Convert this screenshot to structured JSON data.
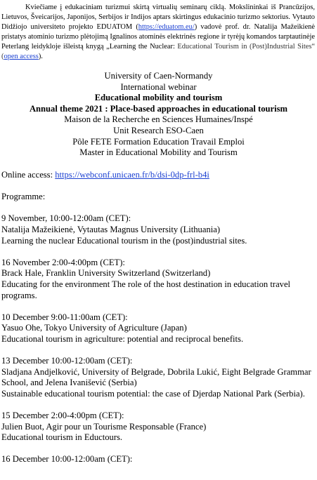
{
  "intro": {
    "t1": "Kviečiame į edukaciniam turizmui skirtą virtualių seminarų ciklą. Mokslininkai iš Prancūzijos, Lietuvos, Šveicarijos, Japonijos, Serbijos ir  Indijos aptars skirtingus edukacinio turizmo sektorius. Vytauto Didžiojo universiteto projekto EDUATOM (",
    "link1": "https://eduatom.eu/",
    "t2": ") vadovė prof. dr. Natalija Mažeikienė pristatys atominio turizmo plėtojimą Ignalinos atominės elektrinės regione ir tyrėjų komandos tarptautinėje Peterlang leidykloje išleistą knygą „Learning the Nuclear:",
    "t3": " Educational Tourism in (Post)Industrial Sites“ (",
    "link2": "open access",
    "t4": ")."
  },
  "header": {
    "university": "University of Caen-Normandy",
    "webinar": "International webinar",
    "title": "Educational mobility and tourism",
    "theme": "Annual theme 2021 : Place-based approaches in educational tourism",
    "org1": "Maison de la Recherche en Sciences Humaines/Inspé",
    "org2": "Unit Research ESO-Caen",
    "org3": "Pôle FETE Formation Education Travail Emploi",
    "org4": "Master in Educational Mobility and Tourism"
  },
  "access": {
    "label": "Online access: ",
    "url": "https://webconf.unicaen.fr/b/dsi-0dp-frl-b4i"
  },
  "programme_label": "Programme:",
  "sessions": [
    {
      "date": "9 November, 10:00-12:00am (CET):",
      "speaker": "Natalija Mažeikienė, Vytautas Magnus University (Lithuania)",
      "title": "Learning the nuclear Educational tourism in the (post)industrial sites."
    },
    {
      "date": "16 November 2:00-4:00pm (CET):",
      "speaker": "Brack Hale, Franklin University Switzerland (Switzerland)",
      "title": "Educating for the environment The role of the host destination in education travel programs."
    },
    {
      "date": "10 December 9:00-11:00am (CET):",
      "speaker": "Yasuo Ohe, Tokyo University of Agriculture (Japan)",
      "title": "Educational tourism in agriculture: potential and reciprocal benefits."
    },
    {
      "date": "13 December 10:00-12:00am (CET):",
      "speaker": "Sladjana Andjelković, University of Belgrade, Dobrila Lukić, Eight Belgrade Grammar School, and Jelena Ivanišević (Serbia)",
      "title": "Sustainable educational tourism potential: the case of Djerdap National Park (Serbia)."
    },
    {
      "date": "15 December 2:00-4:00pm (CET):",
      "speaker": "Julien Buot, Agir pour un Tourisme Responsable (France)",
      "title": "Educational tourism in Eductours."
    },
    {
      "date": "16 December 10:00-12:00am (CET):"
    }
  ]
}
